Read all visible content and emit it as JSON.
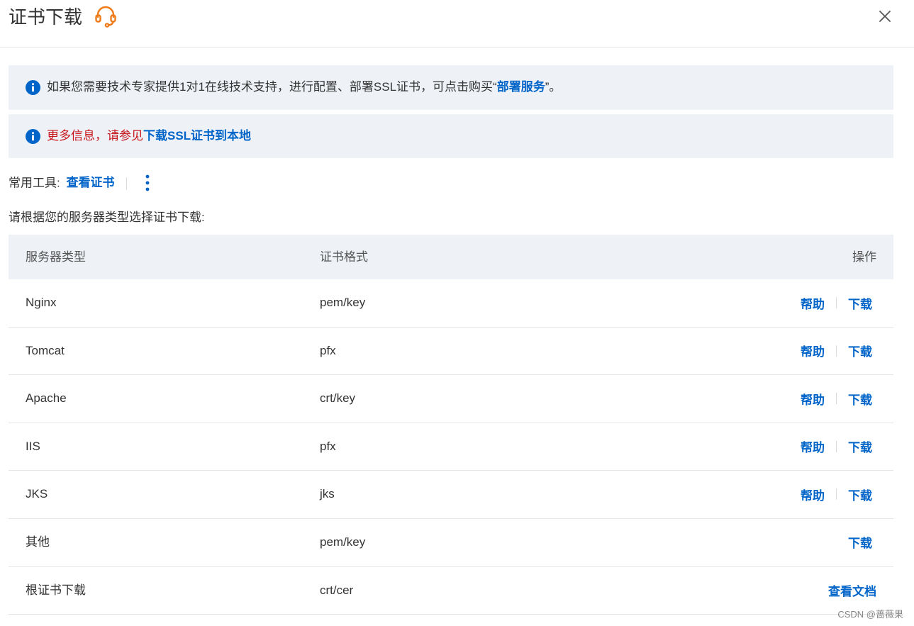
{
  "dialog": {
    "title": "证书下载",
    "close_icon": "close-icon",
    "support_icon": "headset-icon"
  },
  "alerts": [
    {
      "icon": "info-icon",
      "text_before": "如果您需要技术专家提供1对1在线技术支持，进行配置、部署SSL证书，可点击购买“",
      "link": "部署服务",
      "text_after": "”。"
    },
    {
      "icon": "info-icon",
      "text_before": "更多信息，请参见",
      "link": "下载SSL证书到本地",
      "text_after": ""
    }
  ],
  "tools": {
    "label": "常用工具:",
    "view_cert": "查看证书",
    "more_icon": "more-vertical-icon"
  },
  "hint": "请根据您的服务器类型选择证书下载:",
  "table": {
    "headers": {
      "server_type": "服务器类型",
      "format": "证书格式",
      "operations": "操作"
    },
    "rows": [
      {
        "server": "Nginx",
        "format": "pem/key",
        "help": "帮助",
        "download": "下载"
      },
      {
        "server": "Tomcat",
        "format": "pfx",
        "help": "帮助",
        "download": "下载"
      },
      {
        "server": "Apache",
        "format": "crt/key",
        "help": "帮助",
        "download": "下载"
      },
      {
        "server": "IIS",
        "format": "pfx",
        "help": "帮助",
        "download": "下载"
      },
      {
        "server": "JKS",
        "format": "jks",
        "help": "帮助",
        "download": "下载"
      },
      {
        "server": "其他",
        "format": "pem/key",
        "download": "下载"
      },
      {
        "server": "根证书下载",
        "format": "crt/cer",
        "view_doc": "查看文档"
      }
    ]
  },
  "watermark": "CSDN @蔷薇果",
  "colors": {
    "link": "#0064c8",
    "warning_text": "#c7161c",
    "alert_bg": "#eef2f7",
    "support_icon": "#f07a17"
  }
}
